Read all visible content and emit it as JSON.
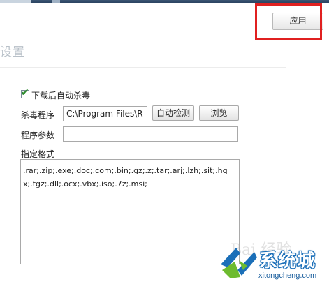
{
  "toolbar": {
    "apply_label": "应用"
  },
  "section": {
    "title": "设置"
  },
  "scan": {
    "auto_scan_label": "下载后自动杀毒",
    "auto_scan_checked": true,
    "antivirus_label": "杀毒程序",
    "antivirus_path": "C:\\Program Files\\R",
    "auto_detect_label": "自动检测",
    "browse_label": "浏览",
    "params_label": "程序参数",
    "params_value": "",
    "formats_label": "指定格式",
    "formats_value": ".rar;.zip;.exe;.doc;.com;.bin;.gz;.z;.tar;.arj;.lzh;.sit;.hqx;.tgz;.dll;.ocx;.vbx;.iso;.7z;.msi;"
  },
  "watermark": {
    "logo_text": "系统城",
    "logo_url": "xitongcheng.com"
  },
  "colors": {
    "highlight": "#e02020",
    "logo_blue": "#1b6fb8",
    "logo_green": "#6dbb2f",
    "check_green": "#2c8a2c"
  }
}
